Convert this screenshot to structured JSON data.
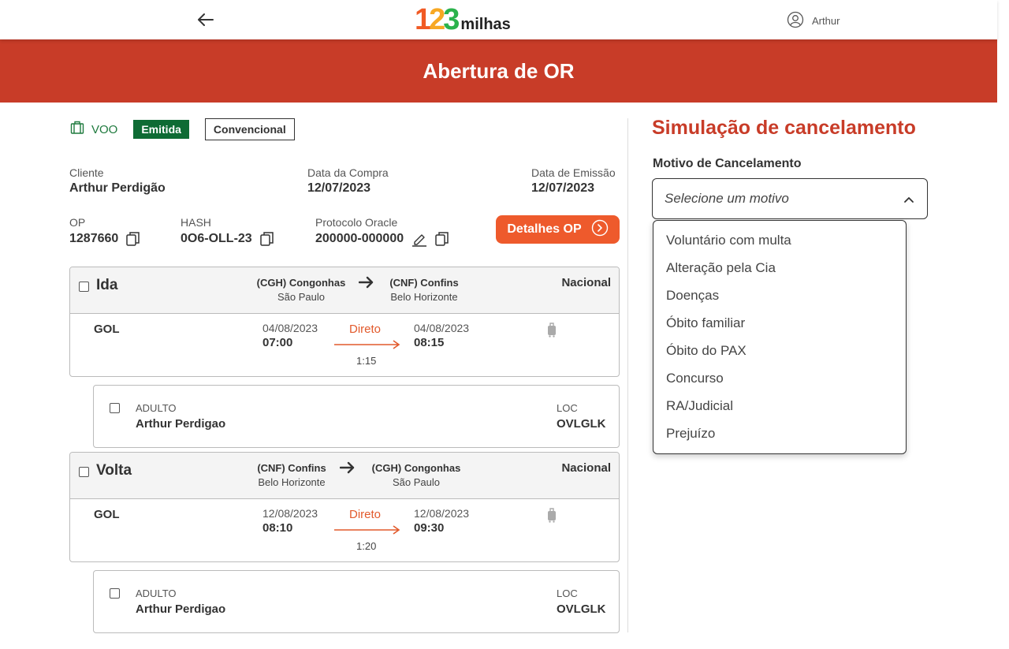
{
  "header": {
    "logo_digits": [
      "1",
      "2",
      "3"
    ],
    "logo_word": "milhas",
    "user_name": "Arthur",
    "page_title": "Abertura de OR"
  },
  "order": {
    "product_label": "VOO",
    "status_badge": "Emitida",
    "type_badge": "Convencional",
    "cliente_label": "Cliente",
    "cliente_value": "Arthur Perdigão",
    "data_compra_label": "Data da Compra",
    "data_compra_value": "12/07/2023",
    "data_emissao_label": "Data de Emissão",
    "data_emissao_value": "12/07/2023",
    "op_label": "OP",
    "op_value": "1287660",
    "hash_label": "HASH",
    "hash_value": "0O6-OLL-23",
    "protocolo_label": "Protocolo Oracle",
    "protocolo_value": "200000-000000",
    "detalhes_button": "Detalhes OP"
  },
  "flights": [
    {
      "direction": "Ida",
      "origin_code": "(CGH) Congonhas",
      "origin_city": "São Paulo",
      "dest_code": "(CNF) Confins",
      "dest_city": "Belo Horizonte",
      "scope": "Nacional",
      "airline": "GOL",
      "dep_date": "04/08/2023",
      "dep_time": "07:00",
      "arr_date": "04/08/2023",
      "arr_time": "08:15",
      "stop_label": "Direto",
      "duration": "1:15",
      "pax_type": "ADULTO",
      "pax_name": "Arthur Perdigao",
      "loc_label": "LOC",
      "loc_value": "OVLGLK"
    },
    {
      "direction": "Volta",
      "origin_code": "(CNF) Confins",
      "origin_city": "Belo Horizonte",
      "dest_code": "(CGH) Congonhas",
      "dest_city": "São Paulo",
      "scope": "Nacional",
      "airline": "GOL",
      "dep_date": "12/08/2023",
      "dep_time": "08:10",
      "arr_date": "12/08/2023",
      "arr_time": "09:30",
      "stop_label": "Direto",
      "duration": "1:20",
      "pax_type": "ADULTO",
      "pax_name": "Arthur Perdigao",
      "loc_label": "LOC",
      "loc_value": "OVLGLK"
    }
  ],
  "simulation": {
    "title": "Simulação de cancelamento",
    "motivo_label": "Motivo de Cancelamento",
    "select_placeholder": "Selecione um motivo",
    "options": [
      "Voluntário com multa",
      "Alteração pela Cia",
      "Doenças",
      "Óbito familiar",
      "Óbito do PAX",
      "Concurso",
      "RA/Judicial",
      "Prejuízo"
    ]
  },
  "colors": {
    "brand_red": "#c83c28",
    "accent_orange": "#ee5a2c",
    "status_green": "#0e6b34"
  }
}
